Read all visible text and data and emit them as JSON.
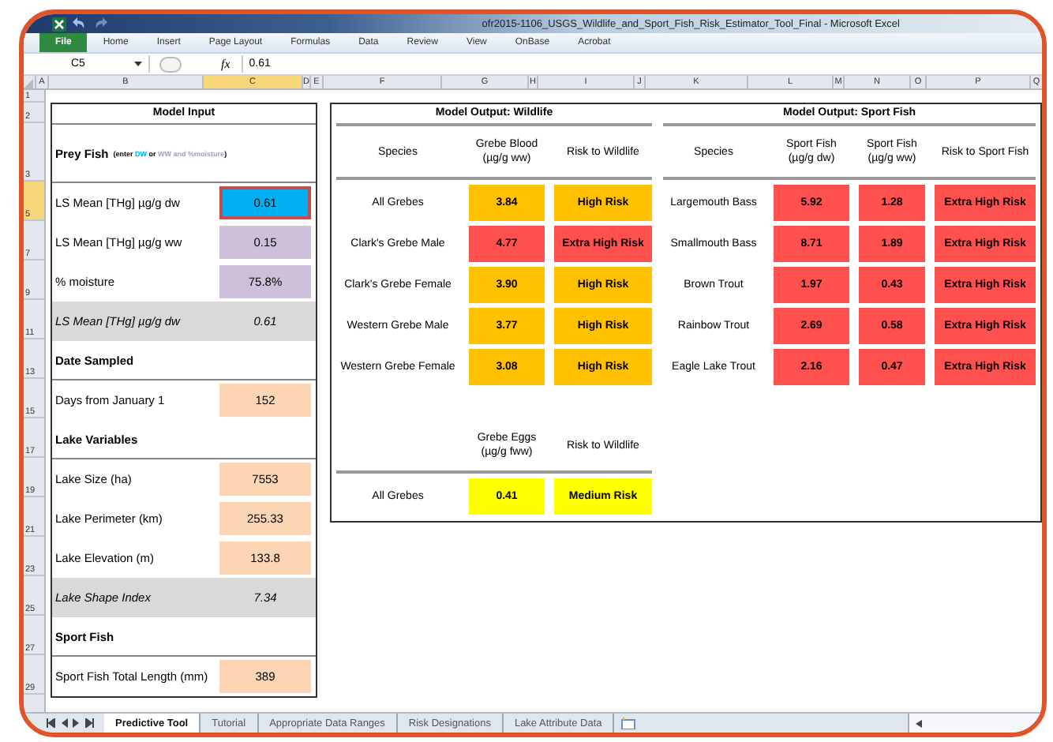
{
  "window": {
    "title": "ofr2015-1106_USGS_Wildlife_and_Sport_Fish_Risk_Estimator_Tool_Final - Microsoft Excel"
  },
  "ribbon_tabs": [
    {
      "label": "File",
      "selected": true
    },
    {
      "label": "Home",
      "selected": false
    },
    {
      "label": "Insert",
      "selected": false
    },
    {
      "label": "Page Layout",
      "selected": false
    },
    {
      "label": "Formulas",
      "selected": false
    },
    {
      "label": "Data",
      "selected": false
    },
    {
      "label": "Review",
      "selected": false
    },
    {
      "label": "View",
      "selected": false
    },
    {
      "label": "OnBase",
      "selected": false
    },
    {
      "label": "Acrobat",
      "selected": false
    }
  ],
  "formula_bar": {
    "name_box": "C5",
    "fx": "fx",
    "value": "0.61"
  },
  "column_headers": [
    {
      "label": "A",
      "selected": false
    },
    {
      "label": "B",
      "selected": false
    },
    {
      "label": "C",
      "selected": true
    },
    {
      "label": "D",
      "selected": false
    },
    {
      "label": "E",
      "selected": false
    },
    {
      "label": "F",
      "selected": false
    },
    {
      "label": "G",
      "selected": false
    },
    {
      "label": "H",
      "selected": false
    },
    {
      "label": "I",
      "selected": false
    },
    {
      "label": "J",
      "selected": false
    },
    {
      "label": "K",
      "selected": false
    },
    {
      "label": "L",
      "selected": false
    },
    {
      "label": "M",
      "selected": false
    },
    {
      "label": "N",
      "selected": false
    },
    {
      "label": "O",
      "selected": false
    },
    {
      "label": "P",
      "selected": false
    },
    {
      "label": "Q",
      "selected": false
    }
  ],
  "row_headers": [
    {
      "label": "1",
      "selected": false
    },
    {
      "label": "2",
      "selected": false
    },
    {
      "label": "3",
      "selected": false
    },
    {
      "label": "5",
      "selected": true
    },
    {
      "label": "7",
      "selected": false
    },
    {
      "label": "9",
      "selected": false
    },
    {
      "label": "11",
      "selected": false
    },
    {
      "label": "13",
      "selected": false
    },
    {
      "label": "15",
      "selected": false
    },
    {
      "label": "17",
      "selected": false
    },
    {
      "label": "19",
      "selected": false
    },
    {
      "label": "21",
      "selected": false
    },
    {
      "label": "23",
      "selected": false
    },
    {
      "label": "25",
      "selected": false
    },
    {
      "label": "27",
      "selected": false
    },
    {
      "label": "29",
      "selected": false
    }
  ],
  "model_input": {
    "title": "Model Input",
    "prey_fish": {
      "heading": "Prey Fish",
      "note": [
        {
          "text": "(enter ",
          "kind": "plain"
        },
        {
          "text": "DW",
          "kind": "dw"
        },
        {
          "text": " or ",
          "kind": "plain"
        },
        {
          "text": "WW and %moisture",
          "kind": "ww"
        },
        {
          "text": ")",
          "kind": "plain"
        }
      ]
    },
    "rows": [
      {
        "kind": "dw",
        "label": "LS Mean [THg] µg/g dw",
        "value": "0.61",
        "selected": true
      },
      {
        "kind": "ww",
        "label": "LS Mean [THg] µg/g ww",
        "value": "0.15",
        "selected": false
      },
      {
        "kind": "ww",
        "label": "% moisture",
        "value": "75.8%",
        "selected": false
      },
      {
        "kind": "calculated",
        "label": "LS Mean [THg] µg/g dw",
        "value": "0.61"
      },
      {
        "kind": "heading",
        "label": "Date Sampled"
      },
      {
        "kind": "input",
        "label": "Days from January 1",
        "value": "152",
        "selected": false
      },
      {
        "kind": "heading",
        "label": "Lake Variables"
      },
      {
        "kind": "input",
        "label": "Lake Size (ha)",
        "value": "7553",
        "selected": false
      },
      {
        "kind": "input",
        "label": "Lake Perimeter (km)",
        "value": "255.33",
        "selected": false
      },
      {
        "kind": "input",
        "label": "Lake Elevation (m)",
        "value": "133.8",
        "selected": false
      },
      {
        "kind": "calculated",
        "label": "Lake Shape Index",
        "value": "7.34"
      },
      {
        "kind": "heading",
        "label": "Sport Fish"
      },
      {
        "kind": "input",
        "label": "Sport Fish Total Length (mm)",
        "value": "389",
        "selected": false
      }
    ]
  },
  "wildlife": {
    "title": "Model Output: Wildlife",
    "columns": [
      "Species",
      "Grebe Blood\n(µg/g ww)",
      "Risk to Wildlife"
    ],
    "rows": [
      {
        "species": "All Grebes",
        "value": "3.84",
        "risk": "High Risk",
        "color": "#ffc000"
      },
      {
        "species": "Clark's Grebe Male",
        "value": "4.77",
        "risk": "Extra High Risk",
        "color": "#ff5050"
      },
      {
        "species": "Clark's Grebe Female",
        "value": "3.90",
        "risk": "High Risk",
        "color": "#ffc000"
      },
      {
        "species": "Western Grebe Male",
        "value": "3.77",
        "risk": "High Risk",
        "color": "#ffc000"
      },
      {
        "species": "Western Grebe Female",
        "value": "3.08",
        "risk": "High Risk",
        "color": "#ffc000"
      }
    ],
    "eggs_columns": [
      "Grebe Eggs\n(µg/g fww)",
      "Risk to Wildlife"
    ],
    "eggs_rows": [
      {
        "species": "All Grebes",
        "value": "0.41",
        "risk": "Medium Risk",
        "color": "#ffff00"
      }
    ]
  },
  "sport_fish": {
    "title": "Model Output: Sport Fish",
    "columns": [
      "Species",
      "Sport Fish\n(µg/g dw)",
      "Sport Fish\n(µg/g ww)",
      "Risk to Sport Fish"
    ],
    "rows": [
      {
        "species": "Largemouth Bass",
        "dw": "5.92",
        "ww": "1.28",
        "risk": "Extra High Risk",
        "color": "#ff5050"
      },
      {
        "species": "Smallmouth Bass",
        "dw": "8.71",
        "ww": "1.89",
        "risk": "Extra High Risk",
        "color": "#ff5050"
      },
      {
        "species": "Brown Trout",
        "dw": "1.97",
        "ww": "0.43",
        "risk": "Extra High Risk",
        "color": "#ff5050"
      },
      {
        "species": "Rainbow Trout",
        "dw": "2.69",
        "ww": "0.58",
        "risk": "Extra High Risk",
        "color": "#ff5050"
      },
      {
        "species": "Eagle Lake Trout",
        "dw": "2.16",
        "ww": "0.47",
        "risk": "Extra High Risk",
        "color": "#ff5050"
      }
    ]
  },
  "sheet_tabs": [
    {
      "label": "Predictive Tool",
      "selected": true
    },
    {
      "label": "Tutorial",
      "selected": false
    },
    {
      "label": "Appropriate Data Ranges",
      "selected": false
    },
    {
      "label": "Risk Designations",
      "selected": false
    },
    {
      "label": "Lake Attribute Data",
      "selected": false
    }
  ]
}
